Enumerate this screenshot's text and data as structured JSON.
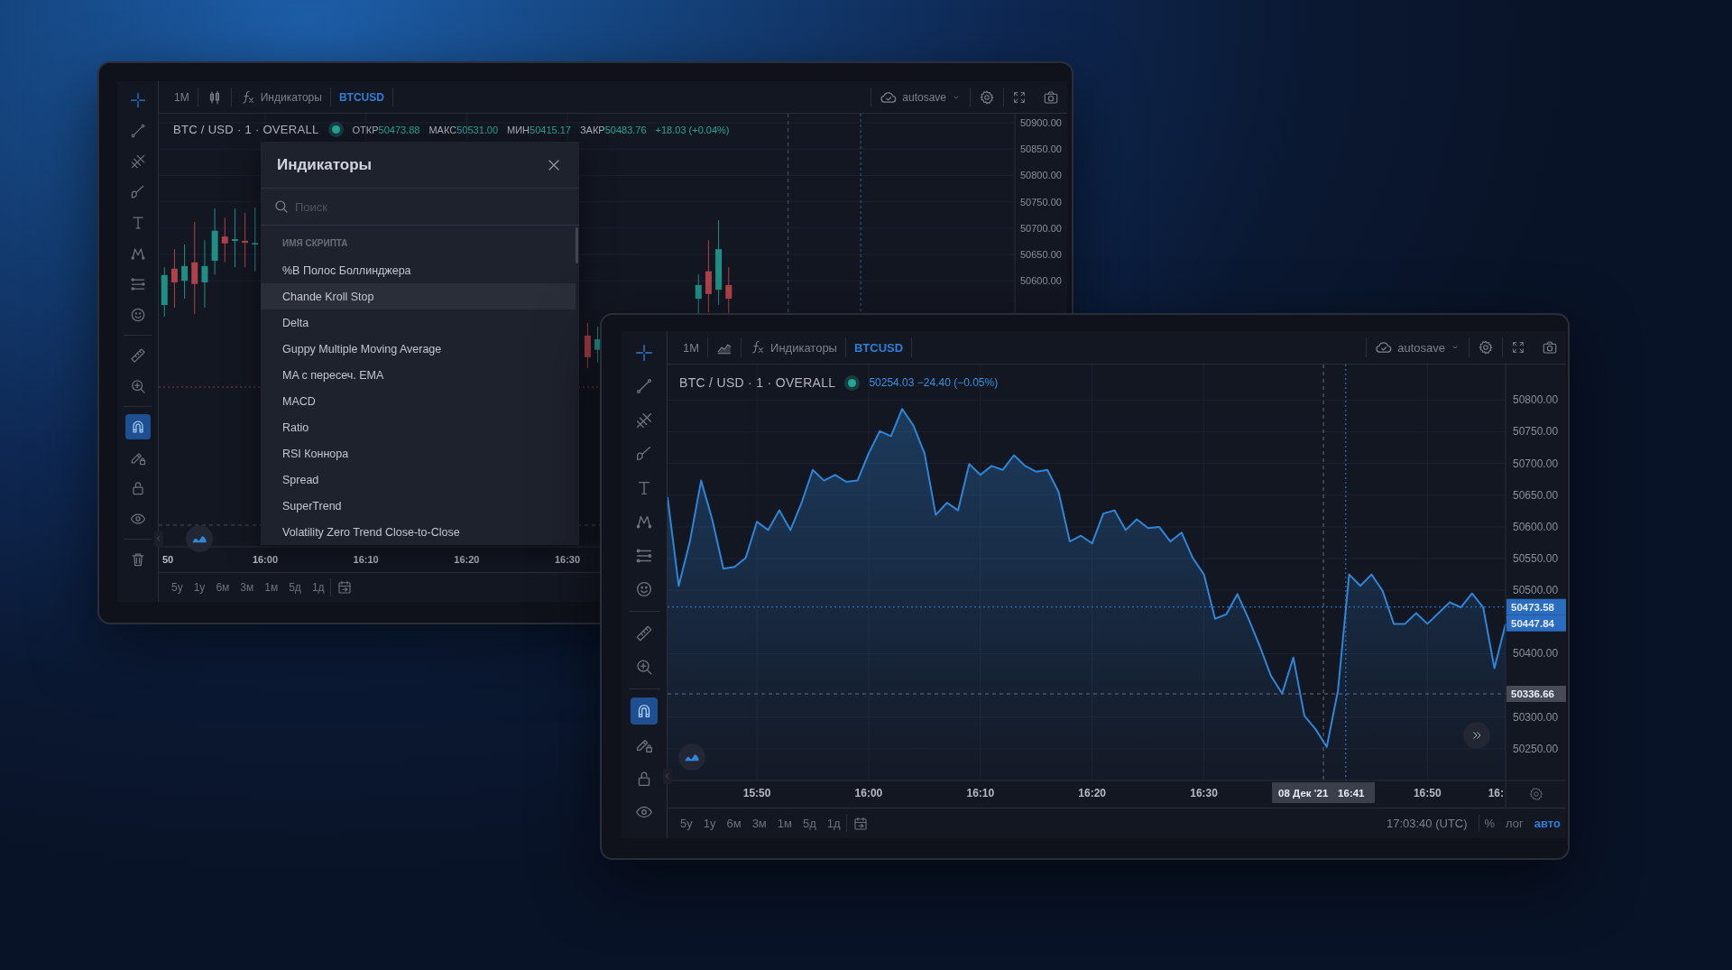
{
  "windows": [
    {
      "kind": "candles",
      "topbar": {
        "interval": "1M",
        "indicators": "Индикаторы",
        "symbol": "BTCUSD",
        "autosave": "autosave"
      },
      "header": {
        "title": "BTC / USD · 1 · OVERALL",
        "live": true,
        "quote": [
          {
            "label": "ОТКР",
            "value": "50473.88"
          },
          {
            "label": "МАКС",
            "value": "50531.00"
          },
          {
            "label": "МИН",
            "value": "50415.17"
          },
          {
            "label": "ЗАКР",
            "value": "50483.76"
          },
          {
            "value": "+18.03 (+0.04%)"
          }
        ]
      },
      "tools": [
        {
          "selected": true
        },
        {
          "selected": false
        },
        {
          "selected": false
        },
        {
          "selected": false
        },
        {
          "selected": false
        },
        {
          "selected": false
        },
        {
          "selected": false
        },
        {
          "selected": false
        },
        {
          "selected": false
        },
        {
          "selected": false
        },
        {
          "selected": true
        },
        {
          "selected": false
        },
        {
          "selected": false
        },
        {
          "selected": false
        },
        {
          "selected": false
        }
      ],
      "chart": {
        "chart_data": {
          "type": "candlestick",
          "grid": true,
          "ylim": [
            50095.2,
            50917.1
          ],
          "categories": [
            "50",
            null,
            null,
            null,
            null,
            null,
            null,
            null,
            null,
            null,
            "16:00",
            null,
            null,
            null,
            null,
            null,
            null,
            null,
            null,
            null,
            "16:10",
            null,
            null,
            null,
            null,
            null,
            null,
            null,
            null,
            null,
            "16:20",
            null,
            null,
            null,
            null,
            null,
            null,
            null,
            null,
            null,
            "16:30",
            null,
            null,
            null,
            null,
            null,
            null,
            null,
            null,
            null,
            null,
            null,
            null,
            null,
            null,
            null,
            null,
            null,
            null,
            null,
            null,
            null,
            null,
            null,
            null,
            null,
            null,
            null,
            null,
            null,
            null,
            null,
            null,
            null,
            null,
            null,
            null,
            null,
            null,
            null,
            null,
            null,
            null,
            null,
            null
          ],
          "ohlc": [
            [
              50554,
              50626,
              50532,
              50611
            ],
            [
              50623,
              50660,
              50549,
              50597
            ],
            [
              50600,
              50669,
              50566,
              50628
            ],
            [
              50635,
              50712,
              50537,
              50594
            ],
            [
              50597,
              50677,
              50549,
              50628
            ],
            [
              50638,
              50737,
              50612,
              50695
            ],
            [
              50684,
              50720,
              50635,
              50671
            ],
            [
              50676,
              50737,
              50626,
              50679
            ],
            [
              50676,
              50729,
              50626,
              50672
            ],
            [
              50669,
              50739,
              50618,
              50672
            ],
            null,
            null,
            null,
            null,
            null,
            null,
            null,
            null,
            null,
            null,
            null,
            null,
            null,
            null,
            null,
            null,
            null,
            null,
            null,
            null,
            null,
            null,
            null,
            null,
            null,
            null,
            null,
            null,
            null,
            null,
            null,
            null,
            [
              50496,
              50520,
              50434,
              50455
            ],
            [
              50469,
              50513,
              50445,
              50489
            ],
            null,
            null,
            null,
            null,
            null,
            null,
            null,
            null,
            null,
            [
              50566,
              50612,
              50537,
              50592
            ],
            [
              50618,
              50677,
              50540,
              50575
            ],
            [
              50583,
              50715,
              50554,
              50660
            ],
            [
              50592,
              50626,
              50539,
              50566
            ],
            null,
            null,
            null,
            null,
            null,
            null,
            null,
            null,
            null,
            null,
            null,
            null,
            null,
            null,
            null,
            null,
            null,
            null,
            null,
            null,
            null,
            null,
            null,
            null,
            null,
            null,
            null,
            null
          ],
          "yticks": [
            {
              "value": 50900,
              "label": "50900.00"
            },
            {
              "value": 50850,
              "label": "50850.00"
            },
            {
              "value": 50800,
              "label": "50800.00"
            },
            {
              "value": 50750,
              "label": "50750.00"
            },
            {
              "value": 50700,
              "label": "50700.00"
            },
            {
              "value": 50650,
              "label": "50650.00"
            },
            {
              "value": 50600,
              "label": "50600.00"
            }
          ],
          "ref_lines": [
            {
              "axis": "y",
              "value": 50398.3
            },
            {
              "axis": "y",
              "value": 50136.3
            }
          ]
        }
      },
      "ranges": [
        "5y",
        "1y",
        "6м",
        "3м",
        "1м",
        "5д",
        "1д"
      ],
      "dialog": {
        "title": "Индикаторы",
        "placeholder": "Поиск",
        "heading": "ИМЯ СКРИПТА",
        "items": [
          {
            "label": "%B Полос Боллинджера",
            "selected": false
          },
          {
            "label": "Chande Kroll Stop",
            "selected": true
          },
          {
            "label": "Delta",
            "selected": false
          },
          {
            "label": "Guppy Multiple Moving Average",
            "selected": false
          },
          {
            "label": "MA с пересеч. EMA",
            "selected": false
          },
          {
            "label": "MACD",
            "selected": false
          },
          {
            "label": "Ratio",
            "selected": false
          },
          {
            "label": "RSI Коннора",
            "selected": false
          },
          {
            "label": "Spread",
            "selected": false
          },
          {
            "label": "SuperTrend",
            "selected": false
          },
          {
            "label": "Volatility Zero Trend Close-to-Close",
            "selected": false
          }
        ]
      }
    },
    {
      "kind": "area",
      "topbar": {
        "interval": "1M",
        "indicators": "Индикаторы",
        "symbol": "BTCUSD",
        "autosave": "autosave"
      },
      "header": {
        "title": "BTC / USD · 1 · OVERALL",
        "live": true,
        "quote": [
          {
            "value": "50254.03 −24.40 (−0.05%)"
          }
        ]
      },
      "tools": [
        {
          "selected": true
        },
        {
          "selected": false
        },
        {
          "selected": false
        },
        {
          "selected": false
        },
        {
          "selected": false
        },
        {
          "selected": false
        },
        {
          "selected": false
        },
        {
          "selected": false
        },
        {
          "selected": false
        },
        {
          "selected": false
        },
        {
          "selected": true
        },
        {
          "selected": false
        },
        {
          "selected": false
        },
        {
          "selected": false
        }
      ],
      "chart": {
        "chart_data": {
          "type": "area",
          "grid": true,
          "ylim": [
            50200,
            50856
          ],
          "categories": [
            null,
            null,
            null,
            null,
            null,
            null,
            null,
            null,
            "15:50",
            null,
            null,
            null,
            null,
            null,
            null,
            null,
            null,
            null,
            "16:00",
            null,
            null,
            null,
            null,
            null,
            null,
            null,
            null,
            null,
            "16:10",
            null,
            null,
            null,
            null,
            null,
            null,
            null,
            null,
            null,
            "16:20",
            null,
            null,
            null,
            null,
            null,
            null,
            null,
            null,
            null,
            "16:30",
            null,
            null,
            null,
            null,
            null,
            null,
            null,
            null,
            null,
            null,
            null,
            null,
            null,
            null,
            null,
            null,
            null,
            null,
            null,
            "16:50",
            null,
            null,
            null,
            null,
            null,
            null,
            null
          ],
          "values": [
            50647,
            50507,
            50577,
            50673,
            50612,
            50534,
            50537,
            50551,
            50608,
            50595,
            50626,
            50595,
            50638,
            50690,
            50673,
            50682,
            50671,
            50673,
            50716,
            50751,
            50743,
            50786,
            50760,
            50716,
            50619,
            50638,
            50626,
            50699,
            50682,
            50696,
            50690,
            50713,
            50696,
            50687,
            50690,
            50655,
            50577,
            50586,
            50574,
            50621,
            50626,
            50595,
            50612,
            50598,
            50600,
            50577,
            50591,
            50551,
            50525,
            50455,
            50462,
            50494,
            50455,
            50412,
            50365,
            50337,
            50394,
            50302,
            50281,
            50253,
            50342,
            50525,
            50507,
            50525,
            50499,
            50447,
            50447,
            50464,
            50447,
            50464,
            50481,
            50473,
            50495,
            50473,
            50377,
            50447
          ],
          "yticks": [
            {
              "value": 50800,
              "label": "50800.00"
            },
            {
              "value": 50750,
              "label": "50750.00"
            },
            {
              "value": 50700,
              "label": "50700.00"
            },
            {
              "value": 50650,
              "label": "50650.00"
            },
            {
              "value": 50600,
              "label": "50600.00"
            },
            {
              "value": 50550,
              "label": "50550.00"
            },
            {
              "value": 50500,
              "label": "50500.00"
            },
            {
              "value": 50400,
              "label": "50400.00"
            },
            {
              "value": 50300,
              "label": "50300.00"
            },
            {
              "value": 50250,
              "label": "50250.00"
            }
          ],
          "ref_lines": [
            {
              "axis": "y",
              "value": 50473.58
            },
            {
              "axis": "y",
              "value": 50336.66
            }
          ]
        },
        "cut_time_label": "16:",
        "price_tags": [
          "50473.58",
          "50447.84"
        ],
        "crosshair": {
          "date": "08 Дек '21",
          "time": "16:41",
          "price": "50336.66"
        }
      },
      "ranges": [
        "5y",
        "1y",
        "6м",
        "3м",
        "1м",
        "5д",
        "1д"
      ],
      "clock": "17:03:40 (UTC)",
      "scale_options": [
        {
          "label": "%",
          "selected": false
        },
        {
          "label": "лог",
          "selected": false
        },
        {
          "label": "авто",
          "selected": true
        }
      ]
    }
  ]
}
